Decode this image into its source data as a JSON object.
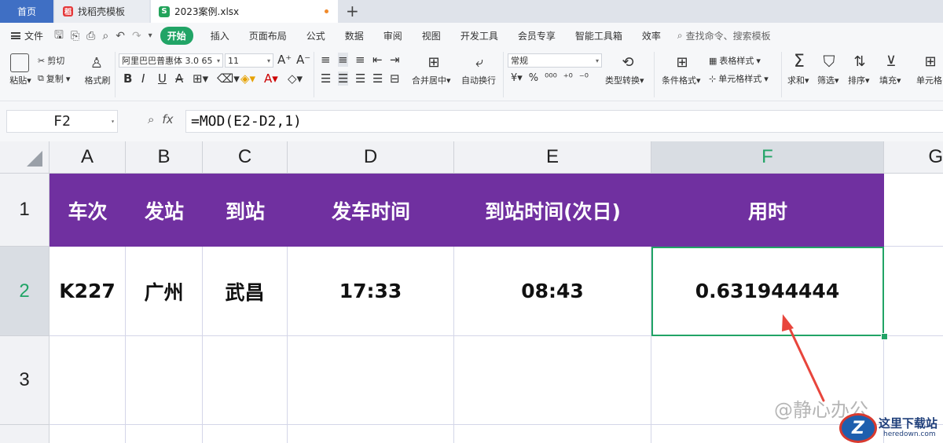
{
  "tabs": {
    "home": "首页",
    "template": "找稻壳模板",
    "file": "2023案例.xlsx",
    "add": "+"
  },
  "menu": {
    "file": "文件",
    "tabs": [
      "开始",
      "插入",
      "页面布局",
      "公式",
      "数据",
      "审阅",
      "视图",
      "开发工具",
      "会员专享",
      "智能工具箱",
      "效率"
    ],
    "search": "查找命令、搜索模板"
  },
  "ribbon": {
    "paste": "粘贴",
    "cut": "剪切",
    "copy": "复制",
    "format_painter": "格式刷",
    "font_name": "阿里巴巴普惠体 3.0 65",
    "font_size": "11",
    "merge_center": "合并居中",
    "wrap_text": "自动换行",
    "number_format": "常规",
    "type_convert": "类型转换",
    "cond_format": "条件格式",
    "table_style": "表格样式",
    "cell_style": "单元格样式",
    "sum": "求和",
    "filter": "筛选",
    "sort": "排序",
    "fill": "填充",
    "cell": "单元格"
  },
  "formula_bar": {
    "name_box": "F2",
    "fx": "fx",
    "formula": "=MOD(E2-D2,1)"
  },
  "grid": {
    "columns": [
      "A",
      "B",
      "C",
      "D",
      "E",
      "F",
      "G"
    ],
    "rows": [
      "1",
      "2",
      "3"
    ],
    "header_row": [
      "车次",
      "发站",
      "到站",
      "发车时间",
      "到站时间(次日)",
      "用时"
    ],
    "data_row": [
      "K227",
      "广州",
      "武昌",
      "17:33",
      "08:43",
      "0.631944444"
    ],
    "header_color": "#7030a0",
    "selection_color": "#21a466"
  },
  "watermark": "@静心办公",
  "site_logo": {
    "name": "这里下载站",
    "url_text": "heredown.com"
  }
}
